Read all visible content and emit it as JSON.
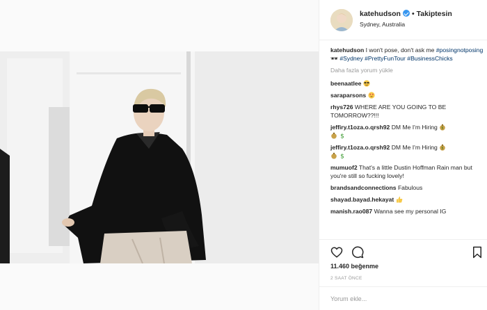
{
  "post": {
    "username": "katehudson",
    "follow_label": "Takiptesin",
    "separator": "•",
    "location": "Sydney, Australia",
    "caption": {
      "username": "katehudson",
      "text": " I won't pose, don't ask me ",
      "tags": [
        "#posingnotposing",
        "#Sydney",
        "#PrettyFunTour",
        "#BusinessChicks"
      ],
      "glasses_emoji": "🕶"
    },
    "load_more": "Daha fazla yorum yükle",
    "comments": [
      {
        "user": "beenaatlee",
        "text": "",
        "emoji": "sunglasses-face"
      },
      {
        "user": "saraparsons",
        "text": "",
        "emoji": "heart-eyes-face"
      },
      {
        "user": "rhys726",
        "text": "WHERE ARE YOU GOING TO BE TOMORROW??!!!",
        "emoji": ""
      },
      {
        "user": "jeffiry.t1oza.o.qrsh92",
        "text": "DM Me I'm Hiring",
        "emoji": "money"
      },
      {
        "user": "jeffiry.t1oza.o.qrsh92",
        "text": "DM Me I'm Hiring",
        "emoji": "money"
      },
      {
        "user": "mumuof2",
        "text": "That's a little Dustin Hoffman Rain man but you're still so fucking lovely!",
        "emoji": ""
      },
      {
        "user": "brandsandconnections",
        "text": "Fabulous",
        "emoji": ""
      },
      {
        "user": "shayad.bayad.hekayat",
        "text": "",
        "emoji": "thumbs-up"
      },
      {
        "user": "manish.rao087",
        "text": "Wanna see my personal IG",
        "emoji": ""
      }
    ],
    "likes": "11.460 beğenme",
    "time": "2 SAAT ÖNCE",
    "comment_placeholder": "Yorum ekle...",
    "actions": {
      "like_icon": "heart-icon",
      "comment_icon": "comment-bubble-icon",
      "save_icon": "bookmark-icon"
    }
  },
  "colors": {
    "hashtag": "#003569",
    "verified": "#3897f0",
    "muted": "#999999",
    "text": "#262626"
  }
}
